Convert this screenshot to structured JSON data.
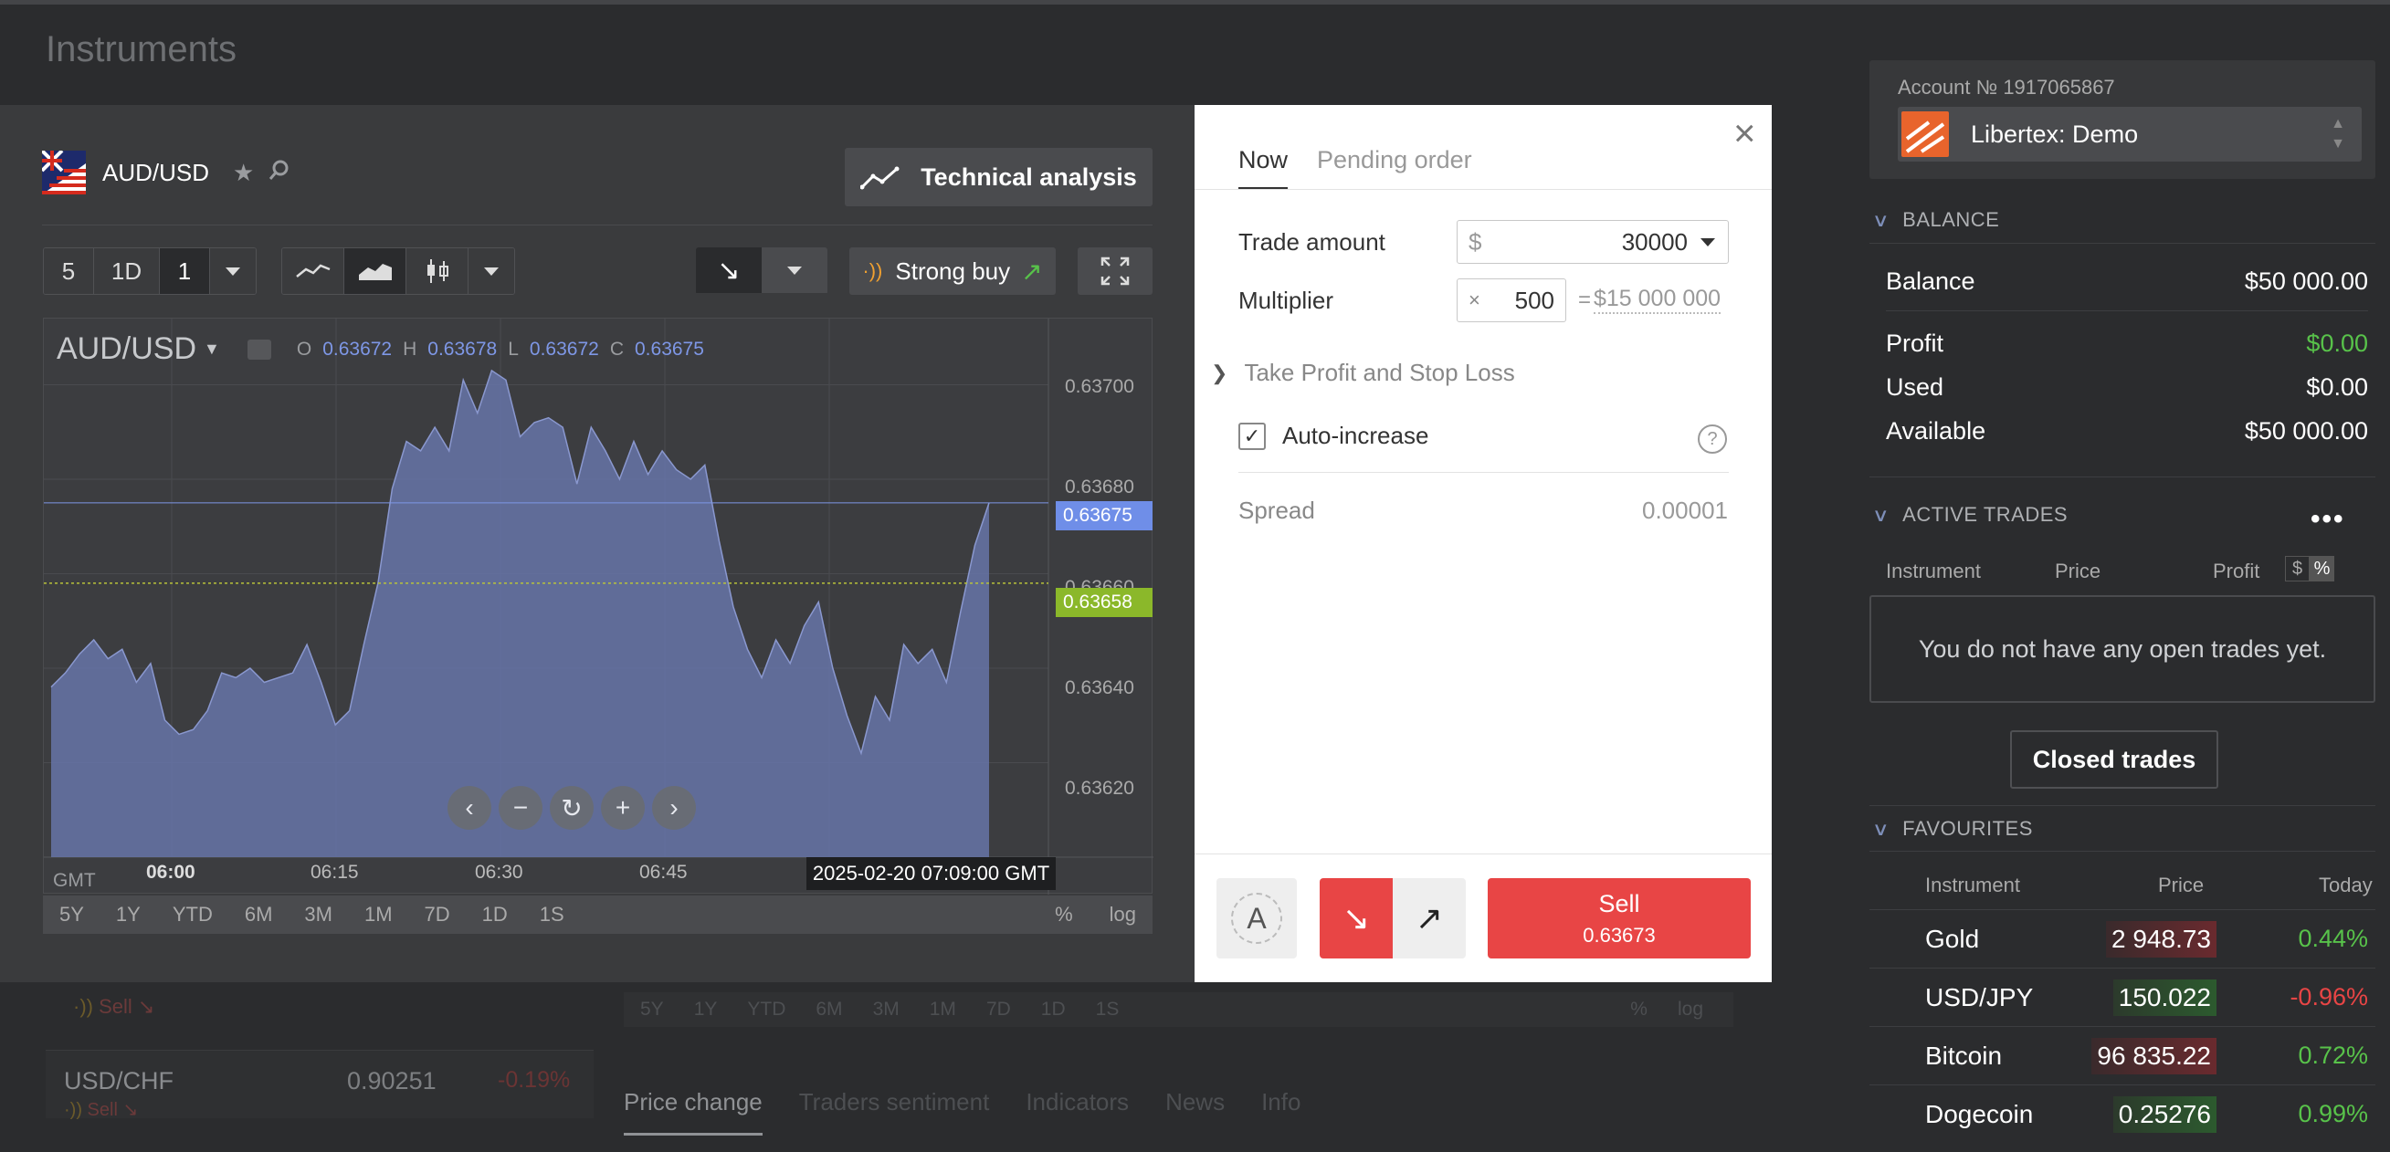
{
  "background": {
    "title": "Instruments",
    "sell_label": "Sell",
    "card": {
      "name": "USD/CHF",
      "price": "0.90251",
      "change": "-0.19%",
      "sell": "Sell"
    },
    "ranges": [
      "5Y",
      "1Y",
      "YTD",
      "6M",
      "3M",
      "1M",
      "7D",
      "1D",
      "1S"
    ],
    "ranges_right": [
      "%",
      "log"
    ],
    "tabs": [
      "Price change",
      "Traders sentiment",
      "Indicators",
      "News",
      "Info"
    ]
  },
  "chart_panel": {
    "symbol": "AUD/USD",
    "technical_analysis_label": "Technical analysis",
    "period_buttons": [
      "5",
      "1D",
      "1"
    ],
    "signal_label": "Strong buy",
    "chart": {
      "pair": "AUD/USD",
      "o_label": "O",
      "o": "0.63672",
      "h_label": "H",
      "h": "0.63678",
      "l_label": "L",
      "l": "0.63672",
      "c_label": "C",
      "c": "0.63675",
      "y_ticks": [
        "0.63700",
        "0.63680",
        "0.63660",
        "0.63640",
        "0.63620"
      ],
      "last_price": "0.63675",
      "marker_price": "0.63658",
      "tz": "GMT",
      "x_ticks": [
        "06:00",
        "06:15",
        "06:30",
        "06:45"
      ],
      "crosshair_time": "2025-02-20 07:09:00 GMT"
    },
    "ranges": [
      "5Y",
      "1Y",
      "YTD",
      "6M",
      "3M",
      "1M",
      "7D",
      "1D",
      "1S"
    ],
    "ranges_right": [
      "%",
      "log"
    ]
  },
  "chart_data": {
    "type": "area",
    "title": "",
    "xlabel": "",
    "ylabel": "",
    "x_ticks": [
      "06:00",
      "06:15",
      "06:30",
      "06:45"
    ],
    "ylim": [
      0.636,
      0.63714
    ],
    "values": [
      0.63636,
      0.63639,
      0.63643,
      0.63646,
      0.63642,
      0.63644,
      0.63637,
      0.63641,
      0.63629,
      0.63626,
      0.63627,
      0.63631,
      0.63639,
      0.63638,
      0.6364,
      0.63637,
      0.63638,
      0.63639,
      0.63645,
      0.63637,
      0.63628,
      0.63631,
      0.63645,
      0.63658,
      0.63678,
      0.63688,
      0.63686,
      0.63691,
      0.63686,
      0.63701,
      0.63694,
      0.63703,
      0.63701,
      0.63689,
      0.63692,
      0.63693,
      0.63691,
      0.63679,
      0.63691,
      0.63686,
      0.6368,
      0.63688,
      0.63681,
      0.63686,
      0.63682,
      0.6368,
      0.63683,
      0.63667,
      0.63653,
      0.63644,
      0.63638,
      0.63646,
      0.63641,
      0.63649,
      0.63654,
      0.6364,
      0.6363,
      0.63622,
      0.63634,
      0.63629,
      0.63645,
      0.63641,
      0.63644,
      0.63637,
      0.63652,
      0.63666,
      0.63675
    ]
  },
  "order_panel": {
    "tab_now": "Now",
    "tab_pending": "Pending order",
    "trade_amount_label": "Trade amount",
    "currency_symbol": "$",
    "trade_amount": "30000",
    "multiplier_label": "Multiplier",
    "multiplier_x": "×",
    "multiplier": "500",
    "equals": "=",
    "exposure": "$15 000 000",
    "tpsl_label": "Take Profit and Stop Loss",
    "auto_increase_label": "Auto-increase",
    "help": "?",
    "spread_label": "Spread",
    "spread": "0.00001",
    "auto_label": "A",
    "sell_label": "Sell",
    "sell_price": "0.63673"
  },
  "sidebar": {
    "account_label": "Account № 1917065867",
    "account_name": "Libertex: Demo",
    "balance_header": "BALANCE",
    "balance": [
      {
        "label": "Balance",
        "value": "$50 000.00"
      },
      {
        "label": "Profit",
        "value": "$0.00"
      },
      {
        "label": "Used",
        "value": "$0.00"
      },
      {
        "label": "Available",
        "value": "$50 000.00"
      }
    ],
    "active_trades_header": "ACTIVE TRADES",
    "active_cols": {
      "instrument": "Instrument",
      "price": "Price",
      "profit": "Profit",
      "cur": "$",
      "pct": "%"
    },
    "empty_text": "You do not have any open trades yet.",
    "closed_trades_label": "Closed trades",
    "favourites_header": "FAVOURITES",
    "fav_cols": {
      "instrument": "Instrument",
      "price": "Price",
      "today": "Today"
    },
    "favourites": [
      {
        "name": "Gold",
        "price": "2 948.73",
        "today": "0.44%"
      },
      {
        "name": "USD/JPY",
        "price": "150.022",
        "today": "-0.96%"
      },
      {
        "name": "Bitcoin",
        "price": "96 835.22",
        "today": "0.72%"
      },
      {
        "name": "Dogecoin",
        "price": "0.25276",
        "today": "0.99%"
      }
    ]
  },
  "colors": {
    "sell": "#e84545",
    "up": "#58c24a",
    "chart_fill": "#6674a8",
    "accent_blue": "#7e97e6",
    "marker_green": "#8bb82a"
  }
}
